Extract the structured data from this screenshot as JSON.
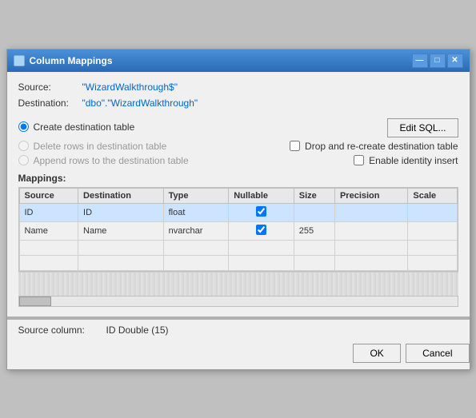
{
  "window": {
    "title": "Column Mappings",
    "icon": "grid-icon",
    "controls": {
      "minimize": "—",
      "maximize": "□",
      "close": "✕"
    }
  },
  "source": {
    "label": "Source:",
    "value": "\"WizardWalkthrough$\""
  },
  "destination": {
    "label": "Destination:",
    "value": "\"dbo\".\"WizardWalkthrough\""
  },
  "options": {
    "create_dest_table": {
      "label": "Create destination table",
      "checked": true,
      "disabled": false
    },
    "delete_rows": {
      "label": "Delete rows in destination table",
      "checked": false,
      "disabled": true
    },
    "append_rows": {
      "label": "Append rows to the destination table",
      "checked": false,
      "disabled": true
    },
    "edit_sql_label": "Edit SQL...",
    "drop_recreate": {
      "label": "Drop and re-create destination table",
      "checked": false
    },
    "enable_identity": {
      "label": "Enable identity insert",
      "checked": false
    }
  },
  "mappings": {
    "label": "Mappings:",
    "columns": [
      "Source",
      "Destination",
      "Type",
      "Nullable",
      "Size",
      "Precision",
      "Scale"
    ],
    "rows": [
      {
        "source": "ID",
        "destination": "ID",
        "type": "float",
        "nullable": true,
        "size": "",
        "precision": "",
        "scale": "",
        "selected": true
      },
      {
        "source": "Name",
        "destination": "Name",
        "type": "nvarchar",
        "nullable": true,
        "size": "255",
        "precision": "",
        "scale": "",
        "selected": false
      }
    ]
  },
  "source_column": {
    "label": "Source column:",
    "value": "ID Double (15)"
  },
  "buttons": {
    "ok": "OK",
    "cancel": "Cancel"
  }
}
